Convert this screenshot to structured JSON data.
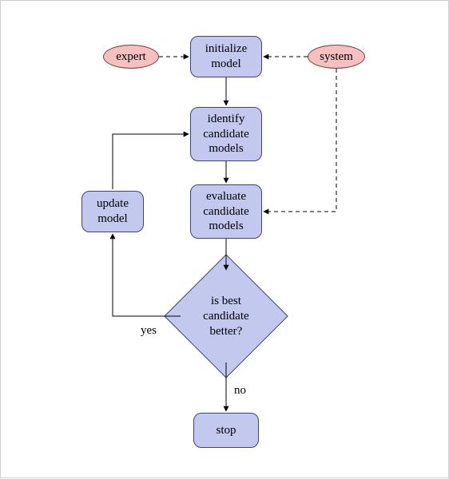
{
  "nodes": {
    "expert": "expert",
    "system": "system",
    "initialize": "initialize\nmodel",
    "identify": "identify\ncandidate\nmodels",
    "evaluate": "evaluate\ncandidate\nmodels",
    "update": "update\nmodel",
    "decision": "is best\ncandidate\nbetter?",
    "stop": "stop"
  },
  "labels": {
    "yes": "yes",
    "no": "no"
  },
  "flow": {
    "type": "flowchart",
    "description": "Iterative model selection loop with expert and system inputs",
    "edges": [
      {
        "from": "expert",
        "to": "initialize",
        "style": "dashed"
      },
      {
        "from": "system",
        "to": "initialize",
        "style": "dashed"
      },
      {
        "from": "system",
        "to": "evaluate",
        "style": "dashed"
      },
      {
        "from": "initialize",
        "to": "identify",
        "style": "solid"
      },
      {
        "from": "identify",
        "to": "evaluate",
        "style": "solid"
      },
      {
        "from": "evaluate",
        "to": "decision",
        "style": "solid"
      },
      {
        "from": "decision",
        "to": "stop",
        "label": "no",
        "style": "solid"
      },
      {
        "from": "decision",
        "to": "update",
        "label": "yes",
        "style": "solid"
      },
      {
        "from": "update",
        "to": "identify",
        "style": "solid"
      }
    ]
  }
}
